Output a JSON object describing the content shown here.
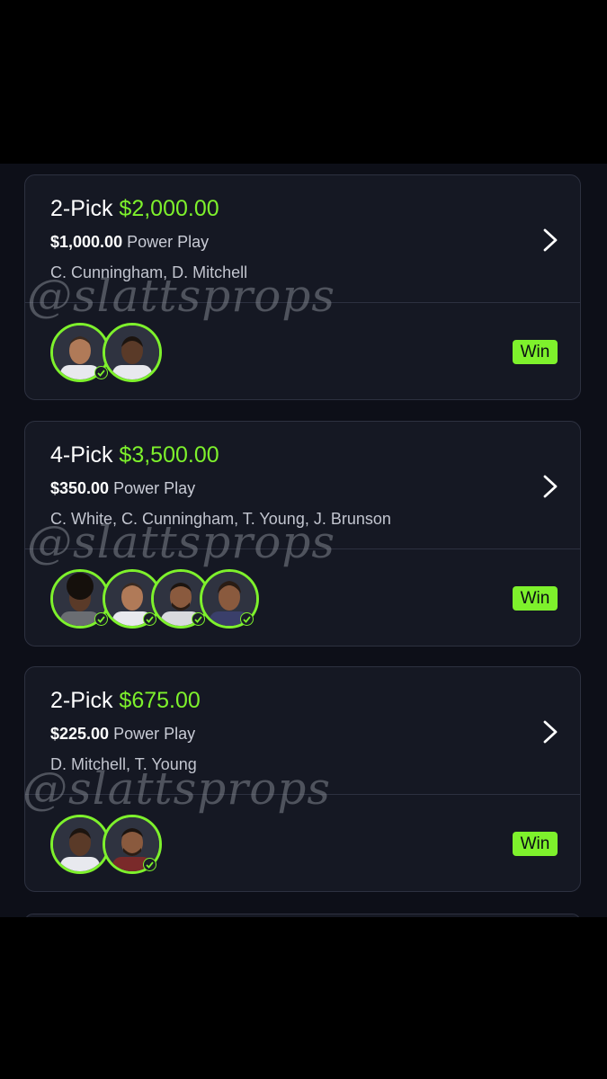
{
  "watermark": "@slattsprops",
  "colors": {
    "accent": "#7ef12c",
    "card": "#151823",
    "background": "#0d0f18"
  },
  "entries": [
    {
      "pick": "2-Pick",
      "payout": "$2,000.00",
      "stake": "$1,000.00",
      "mode": "Power Play",
      "players": "C. Cunningham, D. Mitchell",
      "status": "Win",
      "avatars": 2
    },
    {
      "pick": "4-Pick",
      "payout": "$3,500.00",
      "stake": "$350.00",
      "mode": "Power Play",
      "players": "C. White, C. Cunningham, T. Young, J. Brunson",
      "status": "Win",
      "avatars": 4
    },
    {
      "pick": "2-Pick",
      "payout": "$675.00",
      "stake": "$225.00",
      "mode": "Power Play",
      "players": "D. Mitchell, T. Young",
      "status": "Win",
      "avatars": 2
    }
  ],
  "icons": {
    "open": "chevron-right-icon",
    "status": "check-icon",
    "player": "player-headshot"
  }
}
